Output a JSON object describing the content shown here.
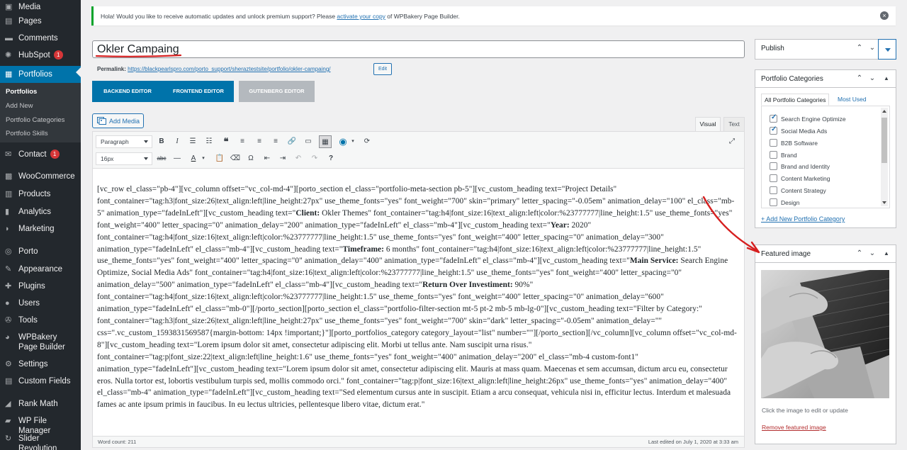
{
  "sidebar": {
    "items": [
      {
        "label": "Media",
        "icon": "media-icon"
      },
      {
        "label": "Pages",
        "icon": "pages-icon"
      },
      {
        "label": "Comments",
        "icon": "comments-icon"
      },
      {
        "label": "HubSpot",
        "icon": "hubspot-icon",
        "badge": "1"
      },
      {
        "label": "Portfolios",
        "icon": "portfolio-icon"
      },
      {
        "label": "Contact",
        "icon": "mail-icon",
        "badge": "1"
      },
      {
        "label": "WooCommerce",
        "icon": "woocommerce-icon"
      },
      {
        "label": "Products",
        "icon": "products-icon"
      },
      {
        "label": "Analytics",
        "icon": "analytics-icon"
      },
      {
        "label": "Marketing",
        "icon": "marketing-icon"
      },
      {
        "label": "Porto",
        "icon": "porto-icon"
      },
      {
        "label": "Appearance",
        "icon": "appearance-icon"
      },
      {
        "label": "Plugins",
        "icon": "plugins-icon"
      },
      {
        "label": "Users",
        "icon": "users-icon"
      },
      {
        "label": "Tools",
        "icon": "tools-icon"
      },
      {
        "label": "WPBakery Page Builder",
        "icon": "wpbakery-icon"
      },
      {
        "label": "Settings",
        "icon": "settings-icon"
      },
      {
        "label": "Custom Fields",
        "icon": "custom-fields-icon"
      },
      {
        "label": "Rank Math",
        "icon": "rank-math-icon"
      },
      {
        "label": "WP File Manager",
        "icon": "file-manager-icon"
      },
      {
        "label": "Slider Revolution",
        "icon": "slider-revolution-icon"
      }
    ],
    "submenu": [
      "Portfolios",
      "Add New",
      "Portfolio Categories",
      "Portfolio Skills"
    ],
    "colors": {
      "bg": "#23282d",
      "current": "#0073aa",
      "badge": "#d63638"
    }
  },
  "notice": {
    "text_before": "Hola! Would you like to receive automatic updates and unlock premium support? Please ",
    "link": "activate your copy",
    "text_after": " of WPBakery Page Builder."
  },
  "post": {
    "title": "Okler Campaing",
    "permalink_label": "Permalink:",
    "permalink_url": "https://blackpearlspro.com/porto_support/sheraztestsite/portfolio/okler-campaing/",
    "permalink_edit": "Edit"
  },
  "editor_switch": {
    "backend": "BACKEND EDITOR",
    "frontend": "FRONTEND EDITOR",
    "gutenberg": "GUTENBERG EDITOR"
  },
  "editor": {
    "add_media": "Add Media",
    "tab_visual": "Visual",
    "tab_text": "Text",
    "format_select": "Paragraph",
    "font_size_select": "16px",
    "word_count": "Word count: 211",
    "last_edited": "Last edited on July 1, 2020 at 3:33 am",
    "content": [
      {
        "t": "[vc_row el_class=\"pb-4\"][vc_column offset=\"vc_col-md-4\"][porto_section el_class=\"portfolio-meta-section pb-5\"][vc_custom_heading text=\"Project Details\" font_container=\"tag:h3|font_size:26|text_align:left|line_height:27px\" use_theme_fonts=\"yes\" font_weight=\"700\" skin=\"primary\" letter_spacing=\"-0.05em\" animation_delay=\"100\" el_class=\"mb-5\" animation_type=\"fadeInLeft\"][vc_custom_heading text=\""
      },
      {
        "b": "Client:"
      },
      {
        "t": " Okler Themes\" font_container=\"tag:h4|font_size:16|text_align:left|color:%23777777|line_height:1.5\" use_theme_fonts=\"yes\" font_weight=\"400\" letter_spacing=\"0\" animation_delay=\"200\" animation_type=\"fadeInLeft\" el_class=\"mb-4\"][vc_custom_heading text=\""
      },
      {
        "b": "Year:"
      },
      {
        "t": " 2020\" font_container=\"tag:h4|font_size:16|text_align:left|color:%23777777|line_height:1.5\" use_theme_fonts=\"yes\" font_weight=\"400\" letter_spacing=\"0\" animation_delay=\"300\" animation_type=\"fadeInLeft\" el_class=\"mb-4\"][vc_custom_heading text=\""
      },
      {
        "b": "Timeframe:"
      },
      {
        "t": " 6 months\" font_container=\"tag:h4|font_size:16|text_align:left|color:%23777777|line_height:1.5\" use_theme_fonts=\"yes\" font_weight=\"400\" letter_spacing=\"0\" animation_delay=\"400\" animation_type=\"fadeInLeft\" el_class=\"mb-4\"][vc_custom_heading text=\""
      },
      {
        "b": "Main Service:"
      },
      {
        "t": " Search Engine Optimize, Social Media Ads\" font_container=\"tag:h4|font_size:16|text_align:left|color:%23777777|line_height:1.5\" use_theme_fonts=\"yes\" font_weight=\"400\" letter_spacing=\"0\" animation_delay=\"500\" animation_type=\"fadeInLeft\" el_class=\"mb-4\"][vc_custom_heading text=\""
      },
      {
        "b": "Return Over Investiment:"
      },
      {
        "t": " 90%\" font_container=\"tag:h4|font_size:16|text_align:left|color:%23777777|line_height:1.5\" use_theme_fonts=\"yes\" font_weight=\"400\" letter_spacing=\"0\" animation_delay=\"600\" animation_type=\"fadeInLeft\" el_class=\"mb-0\"][/porto_section][porto_section el_class=\"portfolio-filter-section mt-5 pt-2 mb-5 mb-lg-0\"][vc_custom_heading text=\"Filter by Category:\" font_container=\"tag:h3|font_size:26|text_align:left|line_height:27px\" use_theme_fonts=\"yes\" font_weight=\"700\" skin=\"dark\" letter_spacing=\"-0.05em\" animation_delay=\"\" css=\".vc_custom_1593831569587{margin-bottom: 14px !important;}\"][porto_portfolios_category category_layout=\"list\" number=\"\"][/porto_section][/vc_column][vc_column offset=\"vc_col-md-8\"][vc_custom_heading text=\"Lorem ipsum dolor sit amet, consectetur adipiscing elit. Morbi ut tellus ante. Nam suscipit urna risus.\" font_container=\"tag:p|font_size:22|text_align:left|line_height:1.6\" use_theme_fonts=\"yes\" font_weight=\"400\" animation_delay=\"200\" el_class=\"mb-4 custom-font1\" animation_type=\"fadeInLeft\"][vc_custom_heading text=\"Lorem ipsum dolor sit amet, consectetur adipiscing elit. Mauris at mass quam. Maecenas et sem accumsan, dictum arcu eu, consectetur eros. Nulla tortor est, lobortis vestibulum turpis sed, mollis commodo orci.\" font_container=\"tag:p|font_size:16|text_align:left|line_height:26px\" use_theme_fonts=\"yes\" animation_delay=\"400\" el_class=\"mb-4\" animation_type=\"fadeInLeft\"][vc_custom_heading text=\"Sed elementum cursus ante in suscipit. Etiam a arcu consequat, vehicula nisi in, efficitur lectus. Interdum et malesuada fames ac ante ipsum primis in faucibus. In eu lectus ultricies, pellentesque libero vitae, dictum erat.\""
      }
    ]
  },
  "publish": {
    "title": "Publish"
  },
  "categories": {
    "title": "Portfolio Categories",
    "tab_all": "All Portfolio Categories",
    "tab_most_used": "Most Used",
    "items": [
      {
        "label": "Search Engine Optimize",
        "checked": true
      },
      {
        "label": "Social Media Ads",
        "checked": true
      },
      {
        "label": "B2B Software",
        "checked": false
      },
      {
        "label": "Brand",
        "checked": false
      },
      {
        "label": "Brand and Identity",
        "checked": false
      },
      {
        "label": "Content Marketing",
        "checked": false
      },
      {
        "label": "Content Strategy",
        "checked": false
      },
      {
        "label": "Design",
        "checked": false
      }
    ],
    "add_new": "+ Add New Portfolio Category"
  },
  "featured": {
    "title": "Featured image",
    "hint": "Click the image to edit or update",
    "remove": "Remove featured image"
  },
  "colors": {
    "accent": "#0073aa",
    "link": "#2271b1",
    "annotation": "#d62020"
  }
}
